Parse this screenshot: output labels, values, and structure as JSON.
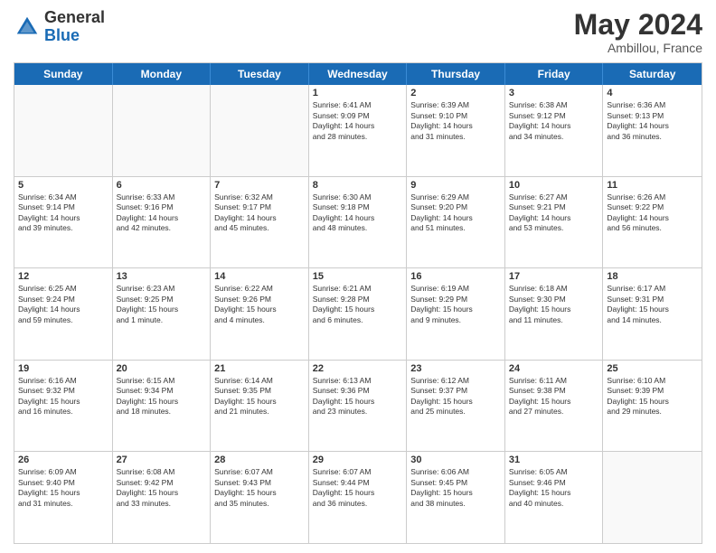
{
  "logo": {
    "general": "General",
    "blue": "Blue"
  },
  "title": "May 2024",
  "subtitle": "Ambillou, France",
  "headers": [
    "Sunday",
    "Monday",
    "Tuesday",
    "Wednesday",
    "Thursday",
    "Friday",
    "Saturday"
  ],
  "weeks": [
    [
      {
        "num": "",
        "info": "",
        "empty": true
      },
      {
        "num": "",
        "info": "",
        "empty": true
      },
      {
        "num": "",
        "info": "",
        "empty": true
      },
      {
        "num": "1",
        "info": "Sunrise: 6:41 AM\nSunset: 9:09 PM\nDaylight: 14 hours\nand 28 minutes."
      },
      {
        "num": "2",
        "info": "Sunrise: 6:39 AM\nSunset: 9:10 PM\nDaylight: 14 hours\nand 31 minutes."
      },
      {
        "num": "3",
        "info": "Sunrise: 6:38 AM\nSunset: 9:12 PM\nDaylight: 14 hours\nand 34 minutes."
      },
      {
        "num": "4",
        "info": "Sunrise: 6:36 AM\nSunset: 9:13 PM\nDaylight: 14 hours\nand 36 minutes."
      }
    ],
    [
      {
        "num": "5",
        "info": "Sunrise: 6:34 AM\nSunset: 9:14 PM\nDaylight: 14 hours\nand 39 minutes."
      },
      {
        "num": "6",
        "info": "Sunrise: 6:33 AM\nSunset: 9:16 PM\nDaylight: 14 hours\nand 42 minutes."
      },
      {
        "num": "7",
        "info": "Sunrise: 6:32 AM\nSunset: 9:17 PM\nDaylight: 14 hours\nand 45 minutes."
      },
      {
        "num": "8",
        "info": "Sunrise: 6:30 AM\nSunset: 9:18 PM\nDaylight: 14 hours\nand 48 minutes."
      },
      {
        "num": "9",
        "info": "Sunrise: 6:29 AM\nSunset: 9:20 PM\nDaylight: 14 hours\nand 51 minutes."
      },
      {
        "num": "10",
        "info": "Sunrise: 6:27 AM\nSunset: 9:21 PM\nDaylight: 14 hours\nand 53 minutes."
      },
      {
        "num": "11",
        "info": "Sunrise: 6:26 AM\nSunset: 9:22 PM\nDaylight: 14 hours\nand 56 minutes."
      }
    ],
    [
      {
        "num": "12",
        "info": "Sunrise: 6:25 AM\nSunset: 9:24 PM\nDaylight: 14 hours\nand 59 minutes."
      },
      {
        "num": "13",
        "info": "Sunrise: 6:23 AM\nSunset: 9:25 PM\nDaylight: 15 hours\nand 1 minute."
      },
      {
        "num": "14",
        "info": "Sunrise: 6:22 AM\nSunset: 9:26 PM\nDaylight: 15 hours\nand 4 minutes."
      },
      {
        "num": "15",
        "info": "Sunrise: 6:21 AM\nSunset: 9:28 PM\nDaylight: 15 hours\nand 6 minutes."
      },
      {
        "num": "16",
        "info": "Sunrise: 6:19 AM\nSunset: 9:29 PM\nDaylight: 15 hours\nand 9 minutes."
      },
      {
        "num": "17",
        "info": "Sunrise: 6:18 AM\nSunset: 9:30 PM\nDaylight: 15 hours\nand 11 minutes."
      },
      {
        "num": "18",
        "info": "Sunrise: 6:17 AM\nSunset: 9:31 PM\nDaylight: 15 hours\nand 14 minutes."
      }
    ],
    [
      {
        "num": "19",
        "info": "Sunrise: 6:16 AM\nSunset: 9:32 PM\nDaylight: 15 hours\nand 16 minutes."
      },
      {
        "num": "20",
        "info": "Sunrise: 6:15 AM\nSunset: 9:34 PM\nDaylight: 15 hours\nand 18 minutes."
      },
      {
        "num": "21",
        "info": "Sunrise: 6:14 AM\nSunset: 9:35 PM\nDaylight: 15 hours\nand 21 minutes."
      },
      {
        "num": "22",
        "info": "Sunrise: 6:13 AM\nSunset: 9:36 PM\nDaylight: 15 hours\nand 23 minutes."
      },
      {
        "num": "23",
        "info": "Sunrise: 6:12 AM\nSunset: 9:37 PM\nDaylight: 15 hours\nand 25 minutes."
      },
      {
        "num": "24",
        "info": "Sunrise: 6:11 AM\nSunset: 9:38 PM\nDaylight: 15 hours\nand 27 minutes."
      },
      {
        "num": "25",
        "info": "Sunrise: 6:10 AM\nSunset: 9:39 PM\nDaylight: 15 hours\nand 29 minutes."
      }
    ],
    [
      {
        "num": "26",
        "info": "Sunrise: 6:09 AM\nSunset: 9:40 PM\nDaylight: 15 hours\nand 31 minutes."
      },
      {
        "num": "27",
        "info": "Sunrise: 6:08 AM\nSunset: 9:42 PM\nDaylight: 15 hours\nand 33 minutes."
      },
      {
        "num": "28",
        "info": "Sunrise: 6:07 AM\nSunset: 9:43 PM\nDaylight: 15 hours\nand 35 minutes."
      },
      {
        "num": "29",
        "info": "Sunrise: 6:07 AM\nSunset: 9:44 PM\nDaylight: 15 hours\nand 36 minutes."
      },
      {
        "num": "30",
        "info": "Sunrise: 6:06 AM\nSunset: 9:45 PM\nDaylight: 15 hours\nand 38 minutes."
      },
      {
        "num": "31",
        "info": "Sunrise: 6:05 AM\nSunset: 9:46 PM\nDaylight: 15 hours\nand 40 minutes."
      },
      {
        "num": "",
        "info": "",
        "empty": true
      }
    ]
  ]
}
